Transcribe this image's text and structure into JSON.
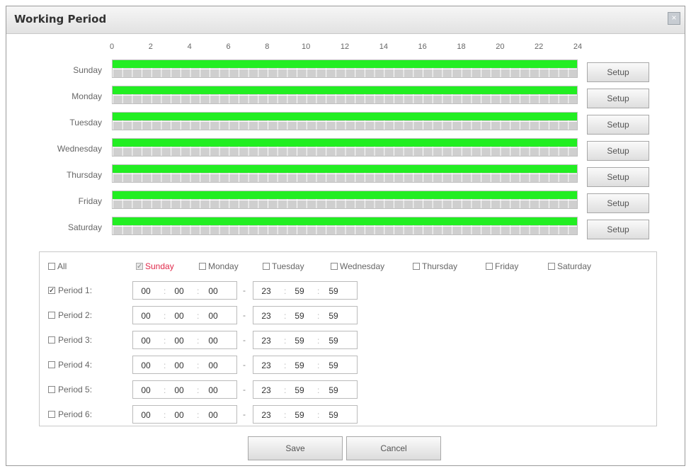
{
  "dialog": {
    "title": "Working Period",
    "close_glyph": "×"
  },
  "hours": [
    "0",
    "2",
    "4",
    "6",
    "8",
    "10",
    "12",
    "14",
    "16",
    "18",
    "20",
    "22",
    "24"
  ],
  "days": [
    {
      "label": "Sunday",
      "setup": "Setup",
      "active_fraction": 1.0
    },
    {
      "label": "Monday",
      "setup": "Setup",
      "active_fraction": 1.0
    },
    {
      "label": "Tuesday",
      "setup": "Setup",
      "active_fraction": 1.0
    },
    {
      "label": "Wednesday",
      "setup": "Setup",
      "active_fraction": 1.0
    },
    {
      "label": "Thursday",
      "setup": "Setup",
      "active_fraction": 1.0
    },
    {
      "label": "Friday",
      "setup": "Setup",
      "active_fraction": 1.0
    },
    {
      "label": "Saturday",
      "setup": "Setup",
      "active_fraction": 1.0
    }
  ],
  "day_checks": [
    {
      "label": "All",
      "checked": false,
      "disabled": false,
      "highlight": false
    },
    {
      "label": "Sunday",
      "checked": true,
      "disabled": true,
      "highlight": true
    },
    {
      "label": "Monday",
      "checked": false,
      "disabled": false,
      "highlight": false
    },
    {
      "label": "Tuesday",
      "checked": false,
      "disabled": false,
      "highlight": false
    },
    {
      "label": "Wednesday",
      "checked": false,
      "disabled": false,
      "highlight": false
    },
    {
      "label": "Thursday",
      "checked": false,
      "disabled": false,
      "highlight": false
    },
    {
      "label": "Friday",
      "checked": false,
      "disabled": false,
      "highlight": false
    },
    {
      "label": "Saturday",
      "checked": false,
      "disabled": false,
      "highlight": false
    }
  ],
  "periods": [
    {
      "label": "Period 1:",
      "checked": true,
      "start": [
        "00",
        "00",
        "00"
      ],
      "end": [
        "23",
        "59",
        "59"
      ]
    },
    {
      "label": "Period 2:",
      "checked": false,
      "start": [
        "00",
        "00",
        "00"
      ],
      "end": [
        "23",
        "59",
        "59"
      ]
    },
    {
      "label": "Period 3:",
      "checked": false,
      "start": [
        "00",
        "00",
        "00"
      ],
      "end": [
        "23",
        "59",
        "59"
      ]
    },
    {
      "label": "Period 4:",
      "checked": false,
      "start": [
        "00",
        "00",
        "00"
      ],
      "end": [
        "23",
        "59",
        "59"
      ]
    },
    {
      "label": "Period 5:",
      "checked": false,
      "start": [
        "00",
        "00",
        "00"
      ],
      "end": [
        "23",
        "59",
        "59"
      ]
    },
    {
      "label": "Period 6:",
      "checked": false,
      "start": [
        "00",
        "00",
        "00"
      ],
      "end": [
        "23",
        "59",
        "59"
      ]
    }
  ],
  "colors": {
    "active": "#22ee22",
    "highlight_text": "#e0294a"
  },
  "buttons": {
    "save": "Save",
    "cancel": "Cancel"
  },
  "icons": {
    "checkmark": "check-icon",
    "close": "close-icon"
  }
}
